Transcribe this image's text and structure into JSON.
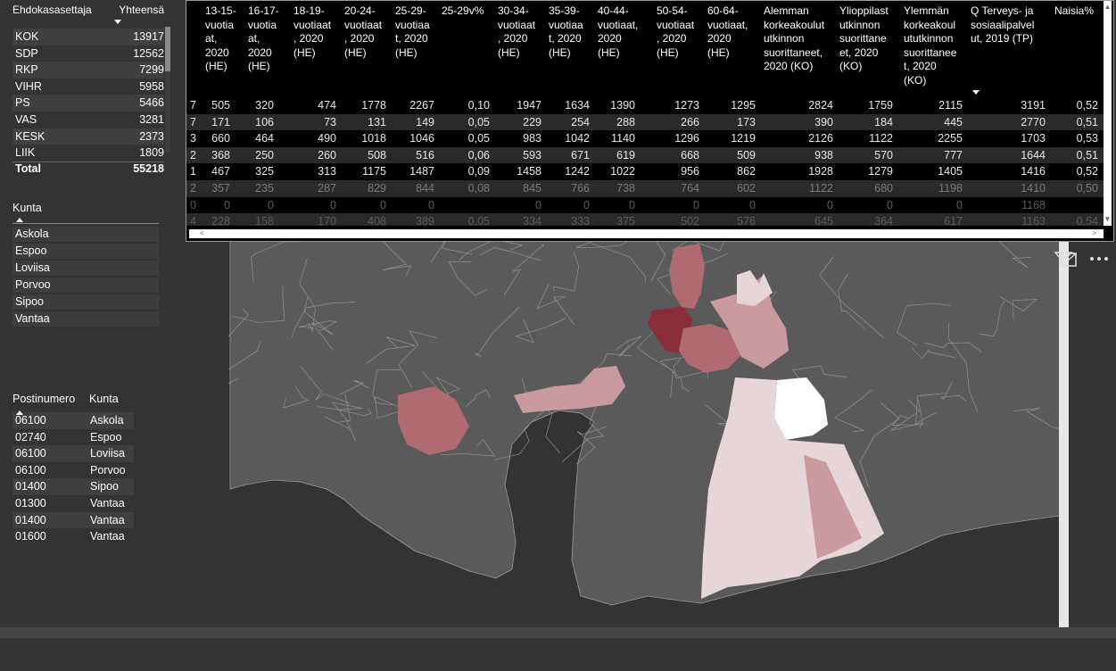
{
  "party_table": {
    "header": {
      "col1": "Ehdokasasettaja",
      "col2": "Yhteensä"
    },
    "rows": [
      {
        "party": "KOK",
        "total": "13917"
      },
      {
        "party": "SDP",
        "total": "12562"
      },
      {
        "party": "RKP",
        "total": "7299"
      },
      {
        "party": "VIHR",
        "total": "5958"
      },
      {
        "party": "PS",
        "total": "5466"
      },
      {
        "party": "VAS",
        "total": "3281"
      },
      {
        "party": "KESK",
        "total": "2373"
      },
      {
        "party": "LIIK",
        "total": "1809"
      }
    ],
    "total": {
      "label": "Total",
      "value": "55218"
    }
  },
  "kunta_slicer": {
    "title": "Kunta",
    "items": [
      "Askola",
      "Espoo",
      "Loviisa",
      "Porvoo",
      "Sipoo",
      "Vantaa"
    ]
  },
  "postcode_table": {
    "header": {
      "col1": "Postinumero",
      "col2": "Kunta"
    },
    "rows": [
      {
        "postinumero": "06100",
        "kunta": "Askola"
      },
      {
        "postinumero": "02740",
        "kunta": "Espoo"
      },
      {
        "postinumero": "06100",
        "kunta": "Loviisa"
      },
      {
        "postinumero": "06100",
        "kunta": "Porvoo"
      },
      {
        "postinumero": "01400",
        "kunta": "Sipoo"
      },
      {
        "postinumero": "01300",
        "kunta": "Vantaa"
      },
      {
        "postinumero": "01400",
        "kunta": "Vantaa"
      },
      {
        "postinumero": "01600",
        "kunta": "Vantaa"
      }
    ]
  },
  "data_table": {
    "columns": [
      "13-15-vuotiaat, 2020 (HE)",
      "16-17-vuotiaat, 2020 (HE)",
      "18-19-vuotiaat, 2020 (HE)",
      "20-24-vuotiaat, 2020 (HE)",
      "25-29-vuotiaat, 2020 (HE)",
      "25-29v%",
      "30-34-vuotiaat, 2020 (HE)",
      "35-39-vuotiaat, 2020 (HE)",
      "40-44-vuotiaat, 2020 (HE)",
      "50-54-vuotiaat, 2020 (HE)",
      "60-64-vuotiaat, 2020 (HE)",
      "Alemman korkeakoulututkinnon suorittaneet, 2020 (KO)",
      "Ylioppilastutkinnon suorittaneet, 2020 (KO)",
      "Ylemmän korkeakoulututkinnon suorittaneet, 2020 (KO)",
      "Q Terveys- ja sosiaalipalvelut, 2019 (TP)",
      "Naisia%"
    ],
    "header_lines": [
      [
        "13-15-",
        "vuotia",
        "at,",
        "2020",
        "(HE)"
      ],
      [
        "16-17-",
        "vuotia",
        "at,",
        "2020",
        "(HE)"
      ],
      [
        "18-19-",
        "vuotiaat",
        ", 2020",
        "(HE)"
      ],
      [
        "20-24-",
        "vuotiaat",
        ", 2020",
        "(HE)"
      ],
      [
        "25-29-",
        "vuotiaa",
        "t, 2020",
        "(HE)"
      ],
      [
        "25-29v%"
      ],
      [
        "30-34-",
        "vuotiaat",
        ", 2020",
        "(HE)"
      ],
      [
        "35-39-",
        "vuotiaa",
        "t, 2020",
        "(HE)"
      ],
      [
        "40-44-",
        "vuotiaat,",
        "2020",
        "(HE)"
      ],
      [
        "50-54-",
        "vuotiaat",
        ", 2020",
        "(HE)"
      ],
      [
        "60-64-",
        "vuotiaat,",
        "2020",
        "(HE)"
      ],
      [
        "Alemman",
        "korkeakoulut",
        "utkinnon",
        "suorittaneet,",
        "2020 (KO)"
      ],
      [
        "Ylioppilast",
        "utkinnon",
        "suorittane",
        "et, 2020",
        "(KO)"
      ],
      [
        "Ylemmän",
        "korkeakoul",
        "ututkinnon",
        "suorittanee",
        "t, 2020",
        "(KO)"
      ],
      [
        "Q Terveys- ja",
        "sosiaalipalvel",
        "ut, 2019 (TP)"
      ],
      [
        "Naisia%"
      ]
    ],
    "rows": [
      {
        "lead": "7",
        "cells": [
          "505",
          "320",
          "474",
          "1778",
          "2267",
          "0,10",
          "1947",
          "1634",
          "1390",
          "1273",
          "1295",
          "2824",
          "1759",
          "2115",
          "3191",
          "0,52"
        ]
      },
      {
        "lead": "7",
        "cells": [
          "171",
          "106",
          "73",
          "131",
          "149",
          "0,05",
          "229",
          "254",
          "288",
          "266",
          "173",
          "390",
          "184",
          "445",
          "2770",
          "0,51"
        ]
      },
      {
        "lead": "3",
        "cells": [
          "660",
          "464",
          "490",
          "1018",
          "1046",
          "0,05",
          "983",
          "1042",
          "1140",
          "1296",
          "1219",
          "2126",
          "1122",
          "2255",
          "1703",
          "0,53"
        ]
      },
      {
        "lead": "2",
        "cells": [
          "368",
          "250",
          "260",
          "508",
          "516",
          "0,06",
          "593",
          "671",
          "619",
          "668",
          "509",
          "938",
          "570",
          "777",
          "1644",
          "0,51"
        ]
      },
      {
        "lead": "1",
        "cells": [
          "467",
          "325",
          "313",
          "1175",
          "1487",
          "0,09",
          "1458",
          "1242",
          "1022",
          "956",
          "862",
          "1928",
          "1279",
          "1405",
          "1416",
          "0,52"
        ]
      },
      {
        "lead": "2",
        "cells": [
          "357",
          "235",
          "287",
          "829",
          "844",
          "0,08",
          "845",
          "766",
          "738",
          "764",
          "602",
          "1122",
          "680",
          "1198",
          "1410",
          "0,50"
        ]
      },
      {
        "lead": "0",
        "cells": [
          "0",
          "0",
          "0",
          "0",
          "0",
          "",
          "0",
          "0",
          "0",
          "0",
          "0",
          "0",
          "0",
          "0",
          "1168",
          ""
        ]
      },
      {
        "lead": "4",
        "cells": [
          "228",
          "158",
          "170",
          "408",
          "389",
          "0,05",
          "334",
          "333",
          "375",
          "502",
          "576",
          "645",
          "364",
          "617",
          "1163",
          "0,54"
        ]
      }
    ]
  },
  "map": {
    "base_fill": "#5a5a5a",
    "border_color": "#9a9a9a",
    "highlight_colors": [
      "#8b2e3b",
      "#b06a72",
      "#c99aa0",
      "#e6d6d8",
      "#ffffff"
    ]
  },
  "icons": {
    "filter": "filter-icon",
    "focus": "focus-mode-icon",
    "more": "more-options-icon"
  }
}
